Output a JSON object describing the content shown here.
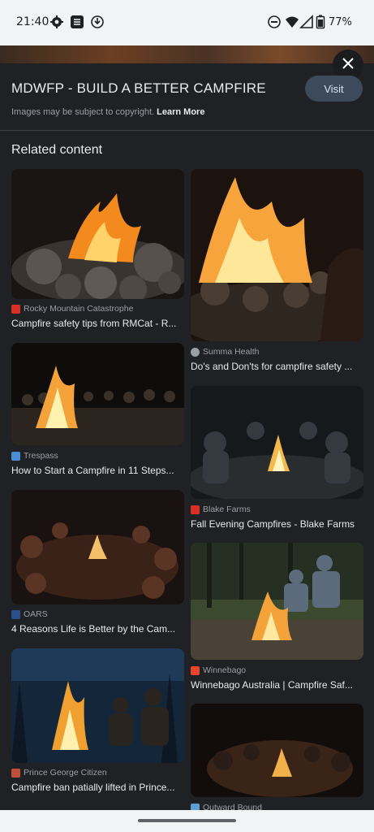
{
  "status_bar": {
    "time": "21:40",
    "battery_percent": "77%",
    "icons": [
      "gear-icon",
      "s-app-icon",
      "vpn-icon",
      "dnd-icon",
      "wifi-icon",
      "signal-icon",
      "battery-icon"
    ]
  },
  "viewer": {
    "source_title": "MDWFP - BUILD A BETTER CAMPFIRE",
    "visit_label": "Visit",
    "copyright_text": "Images may be subject to copyright.",
    "learn_more": "Learn More"
  },
  "related": {
    "heading": "Related content",
    "left": [
      {
        "source": "Rocky Mountain Catastrophe",
        "title": "Campfire safety tips from RMCat - R...",
        "favicon_color": "#d93025"
      },
      {
        "source": "Trespass",
        "title": "How to Start a Campfire in 11 Steps...",
        "favicon_color": "#4a8fd6"
      },
      {
        "source": "OARS",
        "title": "4 Reasons Life is Better by the Cam...",
        "favicon_color": "#2b4f8c"
      },
      {
        "source": "Prince George Citizen",
        "title": "Campfire ban patially lifted in Prince...",
        "favicon_color": "#c0503a"
      }
    ],
    "right": [
      {
        "source": "Summa Health",
        "title": "Do's and Don'ts for campfire safety ...",
        "favicon_color": "#9aa0a6"
      },
      {
        "source": "Blake Farms",
        "title": "Fall Evening Campfires - Blake Farms",
        "favicon_color": "#d93025"
      },
      {
        "source": "Winnebago",
        "title": "Winnebago Australia | Campfire Saf...",
        "favicon_color": "#e8452c"
      },
      {
        "source": "Outward Bound",
        "title": "",
        "favicon_color": "#5f9ed1"
      }
    ]
  }
}
